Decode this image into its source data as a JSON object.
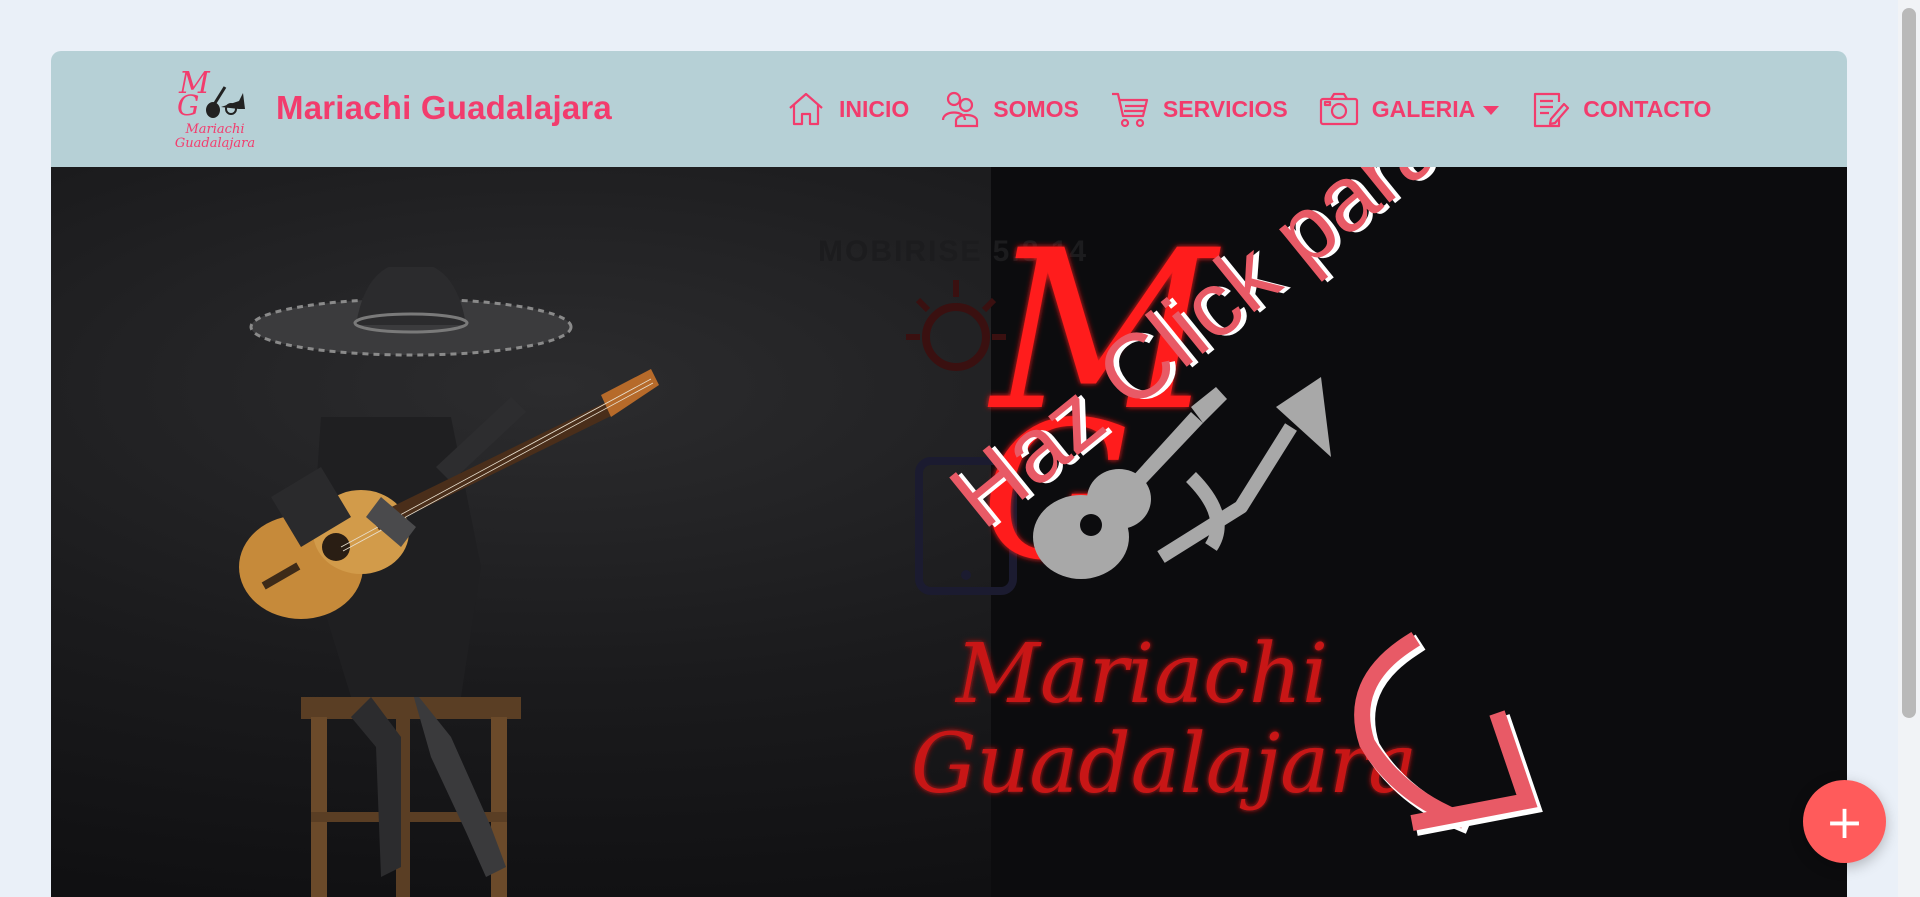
{
  "brand": {
    "title": "Mariachi Guadalajara",
    "logo_text_line1": "Mariachi",
    "logo_text_line2": "Guadalajara",
    "logo_monogram": "M G"
  },
  "nav": {
    "items": [
      {
        "label": "INICIO",
        "icon": "home-icon"
      },
      {
        "label": "SOMOS",
        "icon": "users-icon"
      },
      {
        "label": "SERVICIOS",
        "icon": "cart-icon"
      },
      {
        "label": "GALERIA",
        "icon": "camera-icon",
        "dropdown": true
      },
      {
        "label": "CONTACTO",
        "icon": "edit-document-icon"
      }
    ]
  },
  "hero": {
    "ghost_label": "MOBIRISE 5.8.14",
    "logo_text_line1": "Mariachi",
    "logo_text_line2": "Guadalajara",
    "logo_monogram": "M G",
    "cta_text": "Haz Click para Comenzar"
  },
  "fab": {
    "label": "+"
  },
  "colors": {
    "accent": "#f23c6d",
    "navbar_bg": "#b6d0d6",
    "hero_bg": "#0e0e10",
    "cta": "#e85a66",
    "fab": "#ff5b5b",
    "neon_red": "#ff1a1a"
  }
}
